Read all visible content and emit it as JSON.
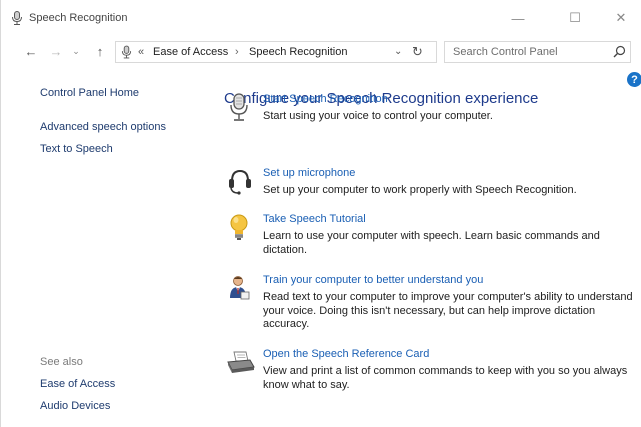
{
  "window": {
    "title": "Speech Recognition",
    "controls": {
      "minimize": "—",
      "maximize": "☐",
      "close": "✕"
    }
  },
  "nav": {
    "back": "←",
    "forward": "→",
    "recent": "⌄",
    "up": "↑"
  },
  "address": {
    "overflow": "«",
    "crumbs": [
      "Ease of Access",
      "Speech Recognition"
    ],
    "separator": "›",
    "dropdown": "⌄",
    "refresh": "↻"
  },
  "search": {
    "placeholder": "Search Control Panel"
  },
  "help": {
    "label": "?"
  },
  "sidebar": {
    "home": "Control Panel Home",
    "links": [
      "Advanced speech options",
      "Text to Speech"
    ],
    "see_also": "See also",
    "see_also_links": [
      "Ease of Access",
      "Audio Devices"
    ]
  },
  "main": {
    "title": "Configure your Speech Recognition experience",
    "tasks": [
      {
        "icon": "microphone-icon",
        "link": "Start Speech Recognition",
        "description": "Start using your voice to control your computer."
      },
      {
        "icon": "headset-icon",
        "link": "Set up microphone",
        "description": "Set up your computer to work properly with Speech Recognition."
      },
      {
        "icon": "lightbulb-icon",
        "link": "Take Speech Tutorial",
        "description": "Learn to use your computer with speech.  Learn basic commands and dictation."
      },
      {
        "icon": "user-training-icon",
        "link": "Train your computer to better understand you",
        "description": "Read text to your computer to improve your computer's ability to understand your voice.  Doing this isn't necessary, but can help improve dictation accuracy."
      },
      {
        "icon": "printer-icon",
        "link": "Open the Speech Reference Card",
        "description": "View and print a list of common commands to keep with you so you always know what to say."
      }
    ]
  },
  "colors": {
    "link": "#1a5fb4",
    "heading": "#1e3b8c",
    "nav_link": "#1e3b6e",
    "help": "#1a73c8"
  }
}
